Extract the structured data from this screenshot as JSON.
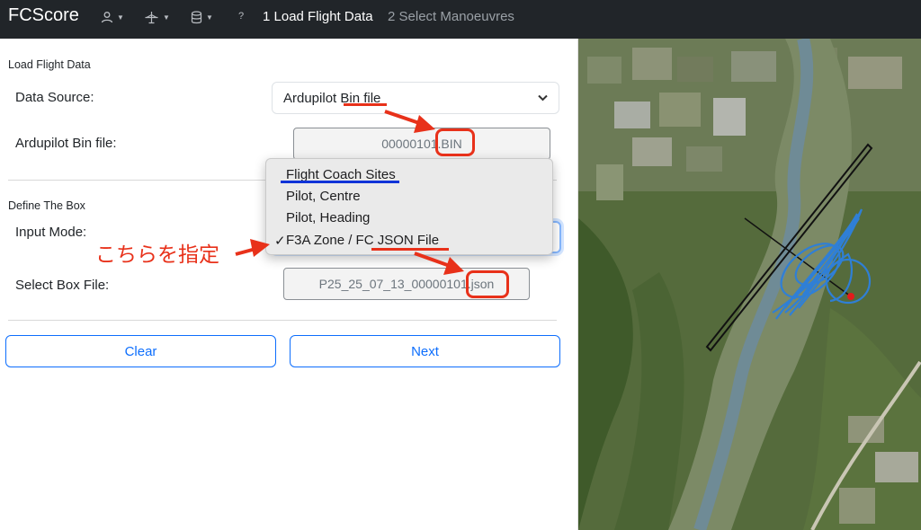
{
  "navbar": {
    "brand": "FCScore",
    "help": "?",
    "step1": "1 Load Flight Data",
    "step2": "2 Select Manoeuvres"
  },
  "load_section": {
    "title": "Load Flight Data",
    "data_source_label": "Data Source:",
    "data_source_value": "Ardupilot Bin file",
    "bin_label": "Ardupilot Bin file:",
    "bin_filename": "00000101.BIN"
  },
  "box_section": {
    "title": "Define The Box",
    "input_mode_label": "Input Mode:",
    "select_box_label": "Select Box File:",
    "box_filename": "P25_25_07_13_00000101.json"
  },
  "dropdown": {
    "options": [
      "Flight Coach Sites",
      "Pilot, Centre",
      "Pilot, Heading",
      "F3A Zone / FC JSON File"
    ],
    "selected_index": 3,
    "check_mark": "✓"
  },
  "buttons": {
    "clear": "Clear",
    "next": "Next"
  },
  "annotation": {
    "text": "こちらを指定"
  },
  "colors": {
    "navbar": "#212529",
    "accent": "#0d6efd",
    "annotation_red": "#e8311a",
    "annotation_blue": "#1034d8",
    "flight_track": "#2f7fd6"
  },
  "icons": [
    "user-icon",
    "plane-icon",
    "database-icon"
  ]
}
